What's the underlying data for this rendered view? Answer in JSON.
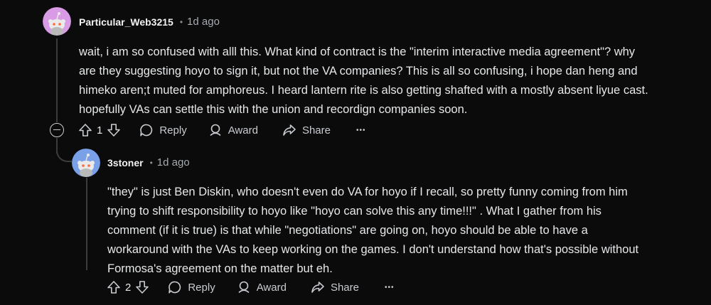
{
  "comments": [
    {
      "username": "Particular_Web3215",
      "time": "1d ago",
      "lines": [
        "wait, i am so confused with alll this. What kind of contract is the \"interim interactive media agreement\"? why",
        "are they suggesting hoyo to sign it, but not the VA companies? This is all so confusing, i hope dan heng and",
        "himeko aren;t muted for amphoreus. I heard lantern rite is also getting shafted with a mostly absent liyue cast.",
        "hopefully VAs can settle this with the union and recordign companies soon."
      ],
      "votes": "1",
      "actions": {
        "reply": "Reply",
        "award": "Award",
        "share": "Share",
        "more": "•••"
      },
      "avatar_color": "#d99be6"
    },
    {
      "username": "3stoner",
      "time": "1d ago",
      "lines": [
        "\"they\" is just Ben Diskin, who doesn't even do VA for hoyo if I recall, so pretty funny coming from him",
        "trying to shift responsibility to hoyo like \"hoyo can solve this any time!!!\" . What I gather from his",
        "comment (if it is true) is that while \"negotiations\" are going on, hoyo should be able to have a",
        "workaround with the VAs to keep working on the games. I don't understand how that's possible without",
        "Formosa's agreement on the matter but eh."
      ],
      "votes": "2",
      "actions": {
        "reply": "Reply",
        "award": "Award",
        "share": "Share",
        "more": "•••"
      },
      "avatar_color": "#7aa0e8"
    }
  ],
  "colors": {
    "background": "#0b0b0c",
    "text": "#e6e8e9",
    "muted": "#a6abb0",
    "thread_line": "#3a3d40"
  }
}
